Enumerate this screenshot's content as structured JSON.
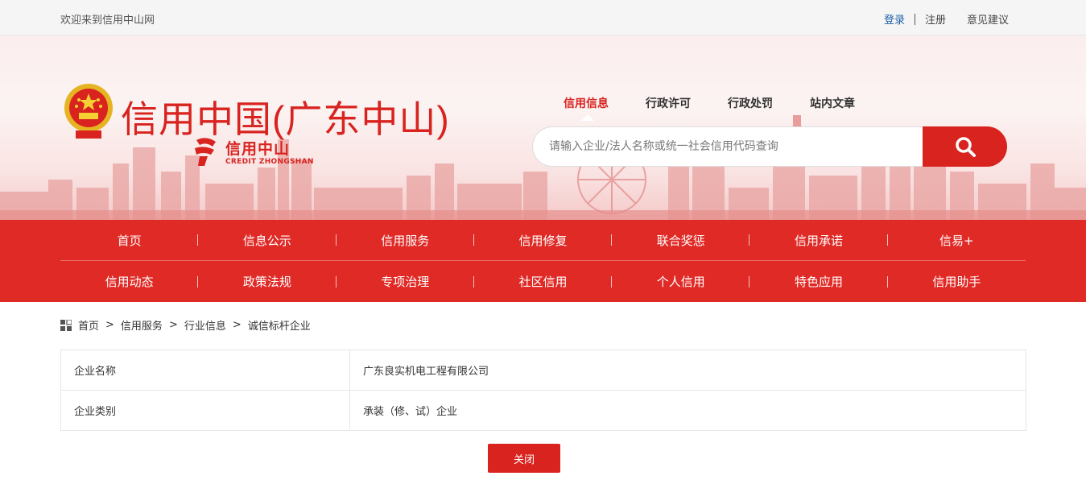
{
  "topbar": {
    "welcome": "欢迎来到信用中山网",
    "login": "登录",
    "register": "注册",
    "feedback": "意见建议"
  },
  "header": {
    "site_title": "信用中国(广东中山)",
    "sub_logo_cn": "信用中山",
    "sub_logo_en": "CREDIT ZHONGSHAN"
  },
  "search": {
    "tabs": [
      "信用信息",
      "行政许可",
      "行政处罚",
      "站内文章"
    ],
    "active_tab": "信用信息",
    "placeholder": "请输入企业/法人名称或统一社会信用代码查询"
  },
  "nav": {
    "row1": [
      "首页",
      "信息公示",
      "信用服务",
      "信用修复",
      "联合奖惩",
      "信用承诺",
      "信易+"
    ],
    "row2": [
      "信用动态",
      "政策法规",
      "专项治理",
      "社区信用",
      "个人信用",
      "特色应用",
      "信用助手"
    ]
  },
  "breadcrumb": [
    "首页",
    "信用服务",
    "行业信息",
    "诚信标杆企业"
  ],
  "detail": [
    {
      "label": "企业名称",
      "value": "广东良实机电工程有限公司"
    },
    {
      "label": "企业类别",
      "value": "承装（修、试）企业"
    }
  ],
  "actions": {
    "close": "关闭"
  },
  "colors": {
    "brand_red": "#d8231f",
    "nav_red": "#e02a26",
    "link_blue": "#1a5fa8"
  }
}
